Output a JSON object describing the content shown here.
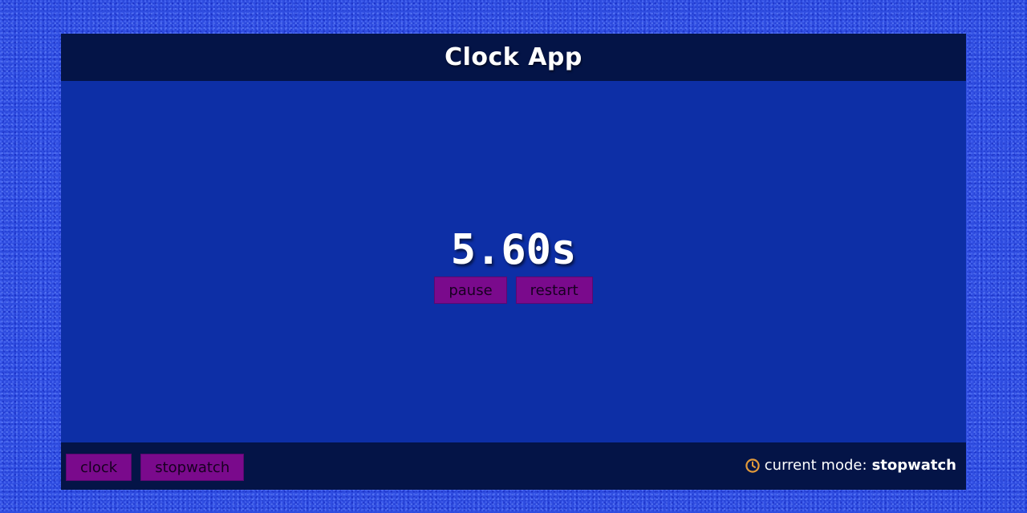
{
  "header": {
    "title": "Clock App"
  },
  "main": {
    "display": "5.60s",
    "controls": {
      "pause_label": "pause",
      "restart_label": "restart"
    }
  },
  "footer": {
    "mode_buttons": {
      "clock_label": "clock",
      "stopwatch_label": "stopwatch"
    },
    "status": {
      "label": "current mode:",
      "value": "stopwatch",
      "icon": "clock-icon"
    }
  },
  "colors": {
    "page_background": "#2f4de0",
    "panel": "#0d2fa6",
    "bars": "#041447",
    "button": "#7a0a8c",
    "icon": "#e39a3a"
  }
}
